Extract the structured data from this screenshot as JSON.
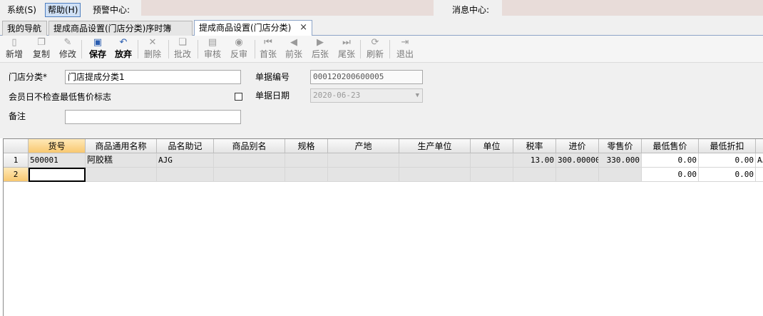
{
  "menu": {
    "system": "系统(S)",
    "help": "帮助(H)",
    "alert_center": "预警中心:",
    "message_center": "消息中心:"
  },
  "tabs": [
    {
      "label": "我的导航"
    },
    {
      "label": "提成商品设置(门店分类)序时簿"
    },
    {
      "label": "提成商品设置(门店分类)",
      "active": true,
      "close_icon": "×"
    }
  ],
  "toolbar": {
    "items": [
      {
        "label": "新增",
        "icon": "new-doc-icon",
        "glyph": "▯",
        "state": "normal"
      },
      {
        "label": "复制",
        "icon": "copy-icon",
        "glyph": "❐",
        "state": "normal"
      },
      {
        "label": "修改",
        "icon": "edit-icon",
        "glyph": "✎",
        "state": "normal"
      },
      {
        "label": "保存",
        "icon": "save-icon",
        "glyph": "▣",
        "state": "active"
      },
      {
        "label": "放弃",
        "icon": "undo-icon",
        "glyph": "↶",
        "state": "active"
      },
      {
        "label": "删除",
        "icon": "delete-icon",
        "glyph": "✕",
        "state": "disabled"
      },
      {
        "label": "批改",
        "icon": "batch-edit-icon",
        "glyph": "❏",
        "state": "disabled"
      },
      {
        "label": "审核",
        "icon": "audit-icon",
        "glyph": "▤",
        "state": "disabled"
      },
      {
        "label": "反审",
        "icon": "unaudit-icon",
        "glyph": "◉",
        "state": "disabled"
      },
      {
        "label": "首张",
        "icon": "first-icon",
        "glyph": "⏮",
        "state": "disabled"
      },
      {
        "label": "前张",
        "icon": "prev-icon",
        "glyph": "◀",
        "state": "disabled"
      },
      {
        "label": "后张",
        "icon": "next-icon",
        "glyph": "▶",
        "state": "disabled"
      },
      {
        "label": "尾张",
        "icon": "last-icon",
        "glyph": "⏭",
        "state": "disabled"
      },
      {
        "label": "刷新",
        "icon": "refresh-icon",
        "glyph": "⟳",
        "state": "disabled"
      },
      {
        "label": "退出",
        "icon": "exit-icon",
        "glyph": "⇥",
        "state": "disabled"
      }
    ]
  },
  "form": {
    "store_category_label": "门店分类*",
    "store_category_value": "门店提成分类1",
    "doc_no_label": "单据编号",
    "doc_no_value": "000120200600005",
    "member_day_label": "会员日不检查最低售价标志",
    "doc_date_label": "单据日期",
    "doc_date_value": "2020-06-23",
    "note_label": "备注",
    "note_value": ""
  },
  "grid": {
    "columns": [
      "货号",
      "商品通用名称",
      "品名助记",
      "商品别名",
      "规格",
      "产地",
      "生产单位",
      "单位",
      "税率",
      "进价",
      "零售价",
      "最低售价",
      "最低折扣"
    ],
    "rows": [
      {
        "num": "1",
        "cells": [
          "500001",
          "阿胶糕",
          "AJG",
          "",
          "",
          "",
          "",
          "",
          "13.00",
          "300.000000",
          "330.000",
          "0.00",
          "0.00",
          "AJ"
        ]
      },
      {
        "num": "2",
        "cells": [
          "",
          "",
          "",
          "",
          "",
          "",
          "",
          "",
          "",
          "",
          "",
          "0.00",
          "0.00",
          ""
        ]
      }
    ]
  }
}
